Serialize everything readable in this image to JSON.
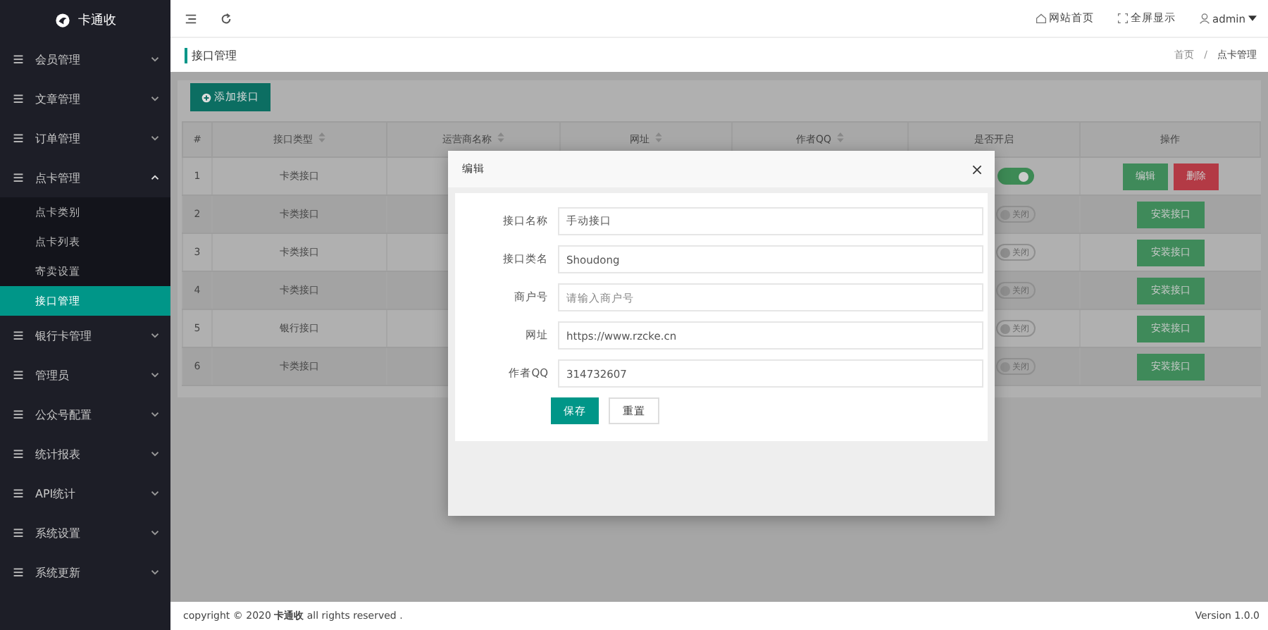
{
  "brand": "卡通收",
  "sidebar": {
    "items": [
      {
        "label": "会员管理",
        "expanded": false
      },
      {
        "label": "文章管理",
        "expanded": false
      },
      {
        "label": "订单管理",
        "expanded": false
      },
      {
        "label": "点卡管理",
        "expanded": true,
        "children": [
          {
            "label": "点卡类别",
            "selected": false
          },
          {
            "label": "点卡列表",
            "selected": false
          },
          {
            "label": "寄卖设置",
            "selected": false
          },
          {
            "label": "接口管理",
            "selected": true
          }
        ]
      },
      {
        "label": "银行卡管理",
        "expanded": false
      },
      {
        "label": "管理员",
        "expanded": false
      },
      {
        "label": "公众号配置",
        "expanded": false
      },
      {
        "label": "统计报表",
        "expanded": false
      },
      {
        "label": "API统计",
        "expanded": false
      },
      {
        "label": "系统设置",
        "expanded": false
      },
      {
        "label": "系统更新",
        "expanded": false
      }
    ]
  },
  "topbar": {
    "links": [
      "网站首页",
      "全屏显示"
    ],
    "user": "admin"
  },
  "page": {
    "title": "接口管理",
    "breadcrumb": [
      "首页",
      "点卡管理"
    ],
    "breadcrumb_separator": "/"
  },
  "add_button": "添加接口",
  "table": {
    "columns": [
      {
        "label": "#",
        "sortable": false
      },
      {
        "label": "接口类型",
        "sortable": true
      },
      {
        "label": "运营商名称",
        "sortable": true
      },
      {
        "label": "网址",
        "sortable": true
      },
      {
        "label": "作者QQ",
        "sortable": true
      },
      {
        "label": "是否开启",
        "sortable": false
      },
      {
        "label": "操作",
        "sortable": false
      }
    ],
    "rows": [
      {
        "num": "1",
        "type": "卡类接口",
        "on": true,
        "actions": [
          {
            "kind": "edit",
            "label": "编辑"
          },
          {
            "kind": "delete",
            "label": "删除"
          }
        ]
      },
      {
        "num": "2",
        "type": "卡类接口",
        "on": false,
        "switch_label": "关闭",
        "actions": [
          {
            "kind": "install",
            "label": "安装接口"
          }
        ]
      },
      {
        "num": "3",
        "type": "卡类接口",
        "on": false,
        "switch_label": "关闭",
        "actions": [
          {
            "kind": "install",
            "label": "安装接口"
          }
        ]
      },
      {
        "num": "4",
        "type": "卡类接口",
        "on": false,
        "switch_label": "关闭",
        "actions": [
          {
            "kind": "install",
            "label": "安装接口"
          }
        ]
      },
      {
        "num": "5",
        "type": "银行接口",
        "on": false,
        "switch_label": "关闭",
        "actions": [
          {
            "kind": "install",
            "label": "安装接口"
          }
        ]
      },
      {
        "num": "6",
        "type": "卡类接口",
        "on": false,
        "switch_label": "关闭",
        "actions": [
          {
            "kind": "install",
            "label": "安装接口"
          }
        ]
      }
    ]
  },
  "dialog": {
    "title": "编辑",
    "fields": [
      {
        "label": "接口名称",
        "value": "手动接口"
      },
      {
        "label": "接口类名",
        "value": "Shoudong"
      },
      {
        "label": "商户号",
        "placeholder": "请输入商户号"
      },
      {
        "label": "网址",
        "value": "https://www.rzcke.cn"
      },
      {
        "label": "作者QQ",
        "value": "314732607"
      }
    ],
    "buttons": [
      {
        "kind": "primary",
        "label": "保存"
      },
      {
        "kind": "default",
        "label": "重置"
      }
    ]
  },
  "footer": {
    "copyright": "copyright © 2020 **卡通收** all rights reserved .",
    "version": "Version 1.0.0"
  }
}
